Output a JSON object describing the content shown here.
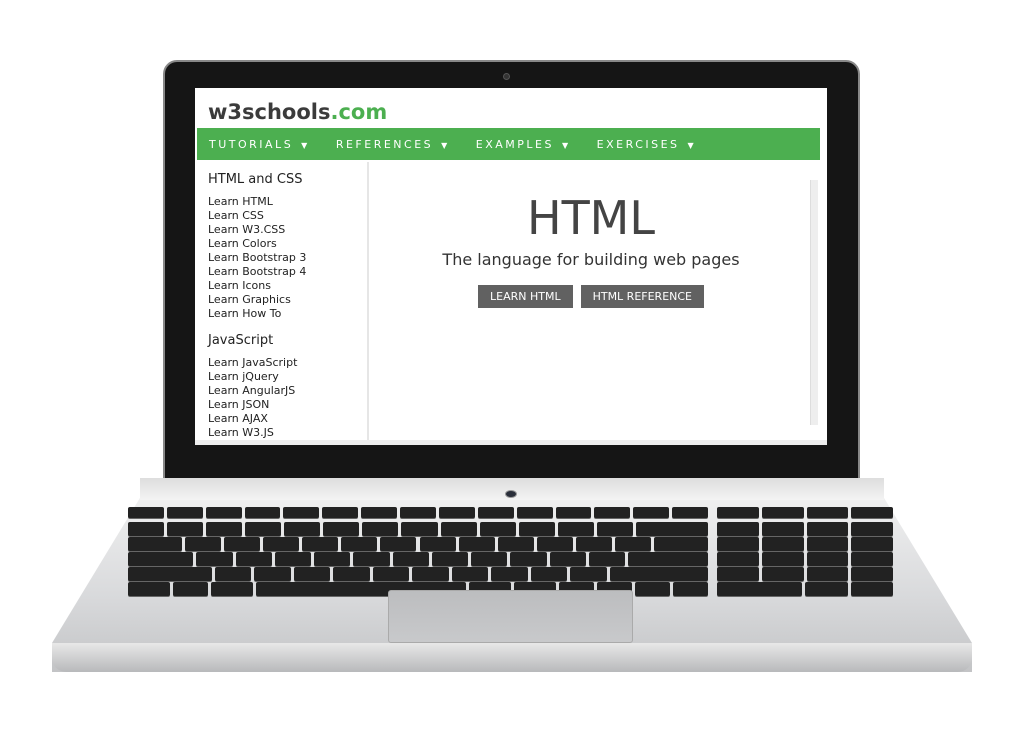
{
  "site": {
    "logo_main": "w3schools",
    "logo_suffix": ".com",
    "nav": [
      "TUTORIALS",
      "REFERENCES",
      "EXAMPLES",
      "EXERCISES"
    ],
    "caret": "▼",
    "sidebar": {
      "section1_title": "HTML and CSS",
      "section1_links": [
        "Learn HTML",
        "Learn CSS",
        "Learn W3.CSS",
        "Learn Colors",
        "Learn Bootstrap 3",
        "Learn Bootstrap 4",
        "Learn Icons",
        "Learn Graphics",
        "Learn How To"
      ],
      "section2_title": "JavaScript",
      "section2_links": [
        "Learn JavaScript",
        "Learn jQuery",
        "Learn AngularJS",
        "Learn JSON",
        "Learn AJAX",
        "Learn W3.JS"
      ]
    },
    "main": {
      "title": "HTML",
      "subtitle": "The language for building web pages",
      "button_learn": "LEARN HTML",
      "button_reference": "HTML REFERENCE"
    },
    "colors": {
      "brand_green": "#4CAF50",
      "button_gray": "#616161"
    }
  }
}
